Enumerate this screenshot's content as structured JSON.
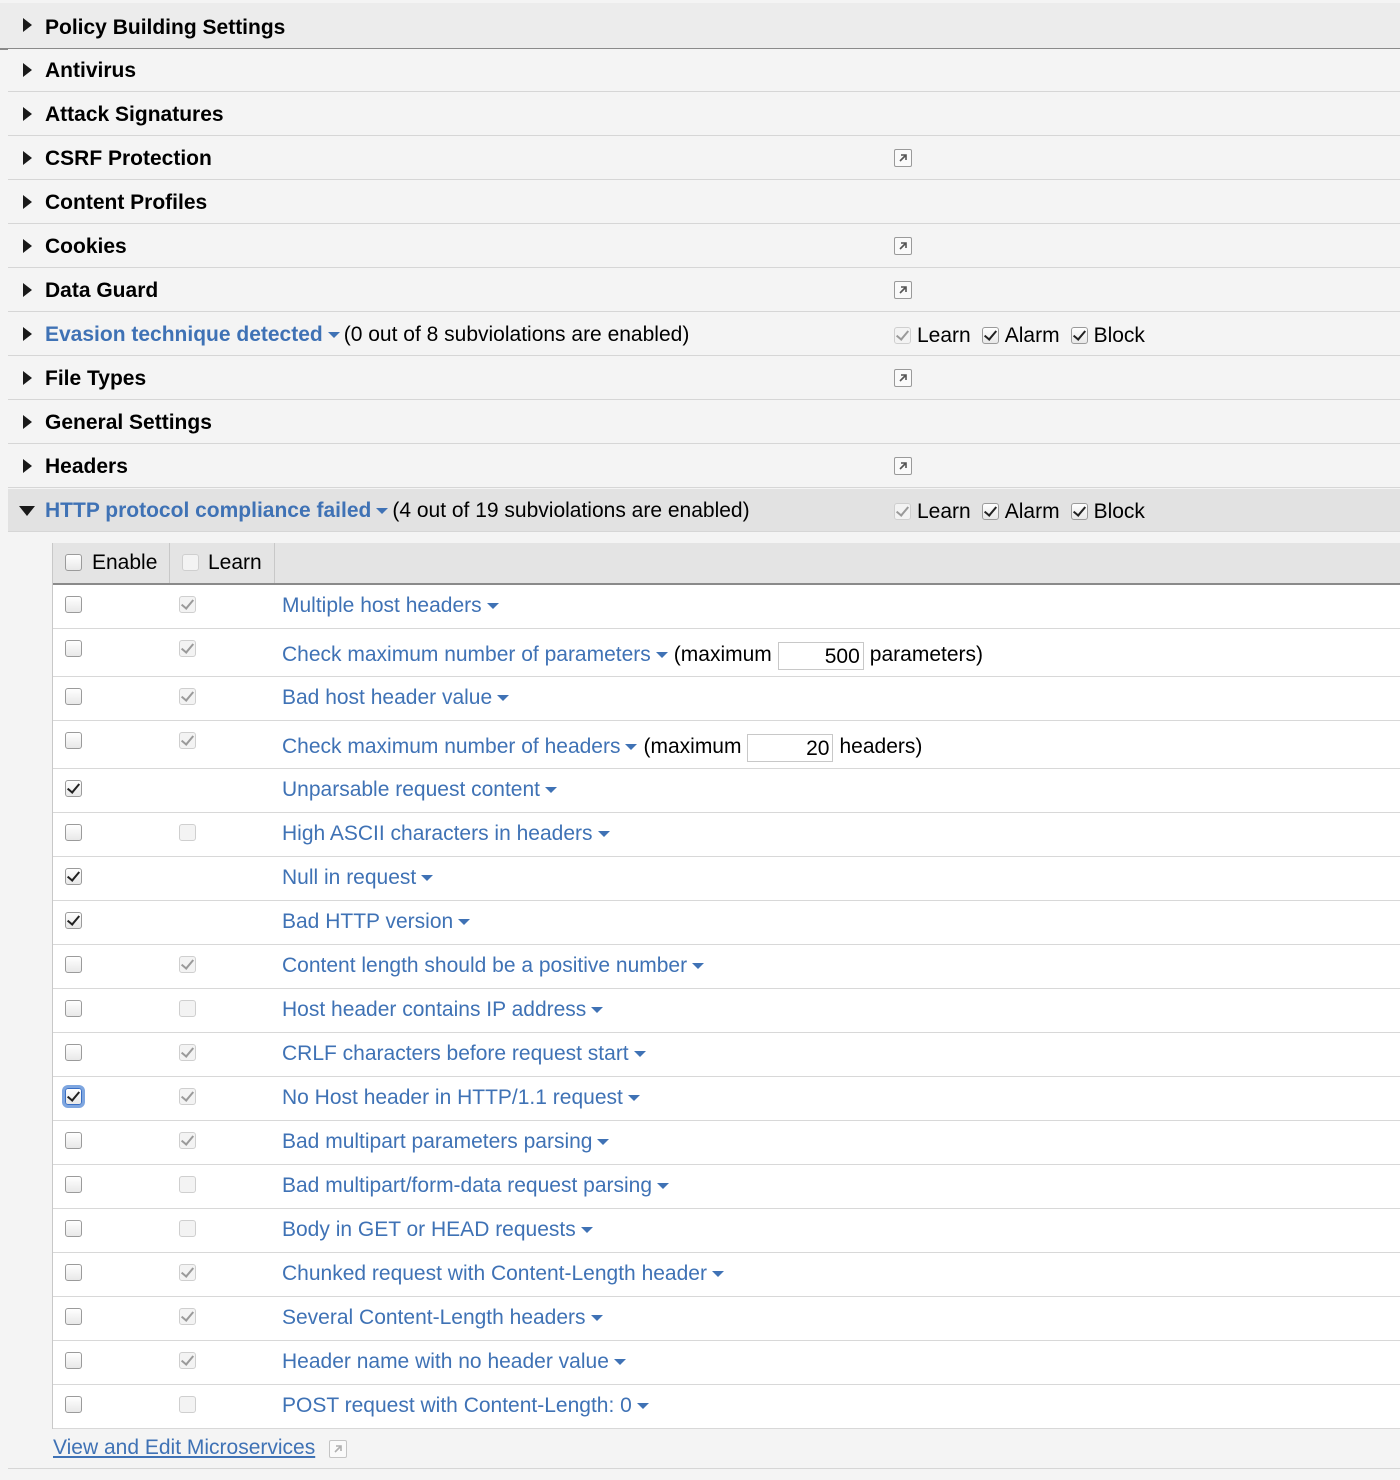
{
  "top_section": {
    "title": "Policy Building Settings"
  },
  "sections": [
    {
      "title": "Antivirus",
      "external_link": false
    },
    {
      "title": "Attack Signatures",
      "external_link": false
    },
    {
      "title": "CSRF Protection",
      "external_link": true
    },
    {
      "title": "Content Profiles",
      "external_link": false
    },
    {
      "title": "Cookies",
      "external_link": true
    },
    {
      "title": "Data Guard",
      "external_link": true
    },
    {
      "title": "Evasion technique detected",
      "link": true,
      "note": "(0 out of 8 subviolations are enabled)",
      "learn": true,
      "alarm": true,
      "block": true
    },
    {
      "title": "File Types",
      "external_link": true
    },
    {
      "title": "General Settings",
      "external_link": false
    },
    {
      "title": "Headers",
      "external_link": true
    },
    {
      "title": "HTTP protocol compliance failed",
      "link": true,
      "expanded": true,
      "note": "(4 out of 19 subviolations are enabled)",
      "learn": true,
      "alarm": true,
      "block": true
    }
  ],
  "flag_labels": {
    "learn": "Learn",
    "alarm": "Alarm",
    "block": "Block"
  },
  "subtable": {
    "headers": {
      "enable": "Enable",
      "learn": "Learn"
    },
    "rows": [
      {
        "name": "Multiple host headers",
        "enabled": false,
        "learn": true
      },
      {
        "name": "Check maximum number of parameters",
        "enabled": false,
        "learn": true,
        "prefix": "(maximum",
        "value": "500",
        "suffix": "parameters)"
      },
      {
        "name": "Bad host header value",
        "enabled": false,
        "learn": true
      },
      {
        "name": "Check maximum number of headers",
        "enabled": false,
        "learn": true,
        "prefix": "(maximum",
        "value": "20",
        "suffix": "headers)"
      },
      {
        "name": "Unparsable request content",
        "enabled": true,
        "learn": null
      },
      {
        "name": "High ASCII characters in headers",
        "enabled": false,
        "learn": false
      },
      {
        "name": "Null in request",
        "enabled": true,
        "learn": null
      },
      {
        "name": "Bad HTTP version",
        "enabled": true,
        "learn": null
      },
      {
        "name": "Content length should be a positive number",
        "enabled": false,
        "learn": true
      },
      {
        "name": "Host header contains IP address",
        "enabled": false,
        "learn": false
      },
      {
        "name": "CRLF characters before request start",
        "enabled": false,
        "learn": true
      },
      {
        "name": "No Host header in HTTP/1.1 request",
        "enabled": true,
        "learn": true,
        "focused": true
      },
      {
        "name": "Bad multipart parameters parsing",
        "enabled": false,
        "learn": true
      },
      {
        "name": "Bad multipart/form-data request parsing",
        "enabled": false,
        "learn": false
      },
      {
        "name": "Body in GET or HEAD requests",
        "enabled": false,
        "learn": false
      },
      {
        "name": "Chunked request with Content-Length header",
        "enabled": false,
        "learn": true
      },
      {
        "name": "Several Content-Length headers",
        "enabled": false,
        "learn": true
      },
      {
        "name": "Header name with no header value",
        "enabled": false,
        "learn": true
      },
      {
        "name": "POST request with Content-Length: 0",
        "enabled": false,
        "learn": false
      }
    ]
  },
  "footer": {
    "link_text": "View and Edit Microservices"
  },
  "colors": {
    "link": "#3f72b5",
    "expanded_row": "#e2e2e2",
    "focus_ring": "#7ea6e0"
  }
}
